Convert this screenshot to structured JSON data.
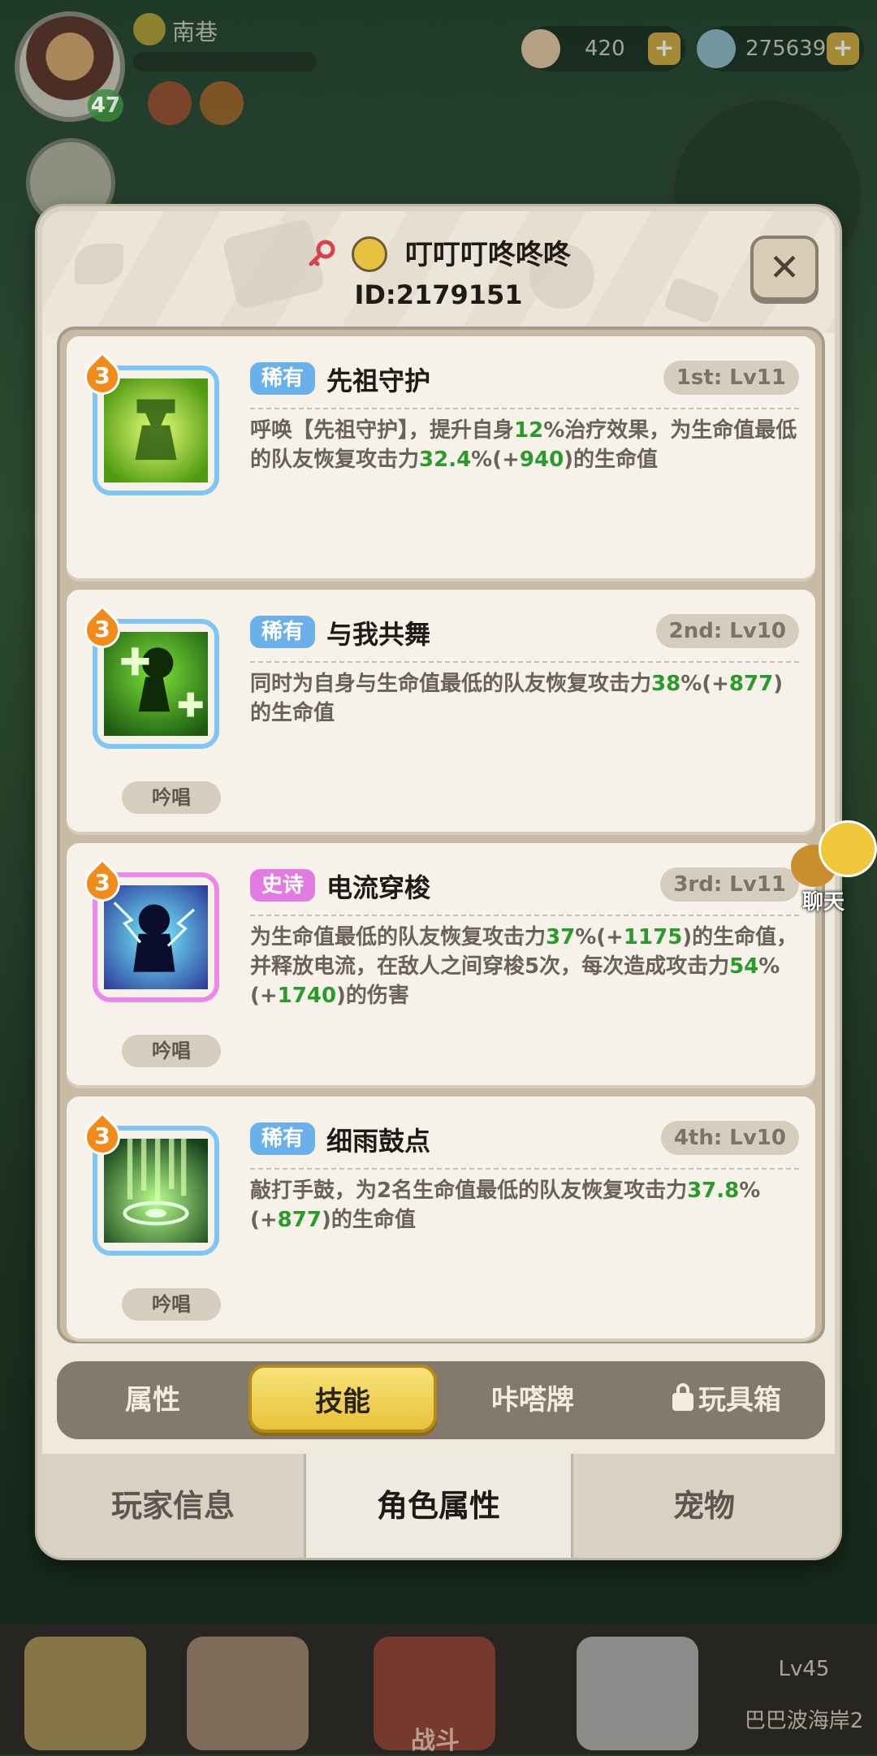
{
  "hud": {
    "player_name": "南巷",
    "player_level": "47",
    "currency_1": "420",
    "currency_2": "275639",
    "plus": "+"
  },
  "modal": {
    "title_name": "叮叮叮咚咚咚",
    "player_id": "ID:2179151",
    "close_label": "✕"
  },
  "skills": [
    {
      "level": "3",
      "rarity": "稀有",
      "rarity_color": "#6ab0ea",
      "name": "先祖守护",
      "slot": "1st: Lv11",
      "desc_parts": [
        "呼唤【先祖守护】，提升自身",
        "12",
        "%治疗效果，为生命值最低的队友恢复攻击力",
        "32.4",
        "%(+",
        "940",
        ")的生命值"
      ],
      "chant": "",
      "icon": "ancestor-guard-icon",
      "icon_frame_color": "#7fc6f2"
    },
    {
      "level": "3",
      "rarity": "稀有",
      "rarity_color": "#6ab0ea",
      "name": "与我共舞",
      "slot": "2nd: Lv10",
      "desc_parts": [
        "同时为自身与生命值最低的队友恢复攻击力",
        "38",
        "%(+",
        "877",
        ")的生命值"
      ],
      "chant": "吟唱",
      "icon": "dance-with-me-icon",
      "icon_frame_color": "#7fc6f2"
    },
    {
      "level": "3",
      "rarity": "史诗",
      "rarity_color": "#e27be0",
      "name": "电流穿梭",
      "slot": "3rd: Lv11",
      "desc_parts": [
        "为生命值最低的队友恢复攻击力",
        "37",
        "%(+",
        "1175",
        ")的生命值，并释放电流，在敌人之间穿梭5次，每次造成攻击力",
        "54",
        "%(+",
        "1740",
        ")的伤害"
      ],
      "chant": "吟唱",
      "icon": "electric-shuttle-icon",
      "icon_frame_color": "#ea8ae6"
    },
    {
      "level": "3",
      "rarity": "稀有",
      "rarity_color": "#6ab0ea",
      "name": "细雨鼓点",
      "slot": "4th: Lv10",
      "desc_parts": [
        "敲打手鼓，为2名生命值最低的队友恢复攻击力",
        "37.8",
        "%(+",
        "877",
        ")的生命值"
      ],
      "chant": "吟唱",
      "icon": "drizzle-drum-icon",
      "icon_frame_color": "#7fc6f2"
    }
  ],
  "segments": [
    "属性",
    "技能",
    "咔嗒牌",
    "玩具箱"
  ],
  "bottom_tabs": [
    "玩家信息",
    "角色属性",
    "宠物"
  ],
  "chat_label": "聊天",
  "bottom_bar": {
    "battle_label": "战斗",
    "locked_level": "Lv45",
    "locked_stage": "巴巴波海岸2"
  },
  "colors": {
    "accent_yellow": "#f0cd4a",
    "green_value": "#2a9b2a"
  }
}
